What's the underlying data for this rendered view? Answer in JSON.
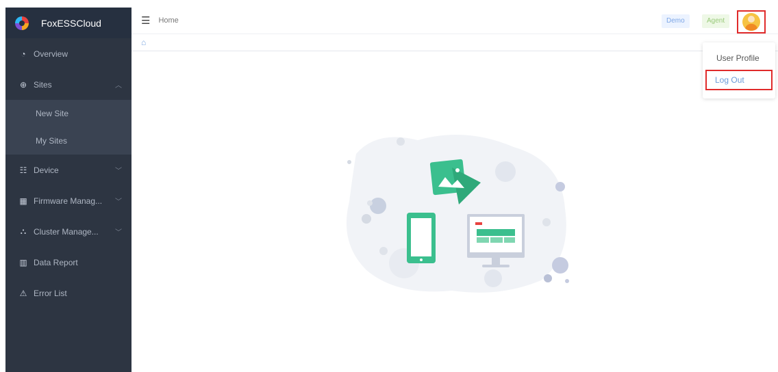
{
  "app": {
    "brand": "FoxESSCloud"
  },
  "sidebar": {
    "items": [
      {
        "icon": "dashboard-icon",
        "label": "Overview"
      },
      {
        "icon": "plus-circle-icon",
        "label": "Sites",
        "expanded": true,
        "children": [
          {
            "label": "New Site"
          },
          {
            "label": "My Sites"
          }
        ]
      },
      {
        "icon": "device-icon",
        "label": "Device"
      },
      {
        "icon": "firmware-icon",
        "label": "Firmware Manag..."
      },
      {
        "icon": "cluster-icon",
        "label": "Cluster Manage..."
      },
      {
        "icon": "chart-icon",
        "label": "Data Report"
      },
      {
        "icon": "error-list-icon",
        "label": "Error List"
      }
    ]
  },
  "header": {
    "breadcrumb": "Home",
    "tags": {
      "demo": "Demo",
      "agent": "Agent"
    }
  },
  "user_menu": {
    "items": [
      {
        "label": "User Profile"
      },
      {
        "label": "Log Out"
      }
    ]
  },
  "colors": {
    "sidebar_bg": "#2d3542",
    "submenu_bg": "#3a4352",
    "highlight_border": "#e02a2a",
    "illustration_green": "#3bbf8e"
  }
}
